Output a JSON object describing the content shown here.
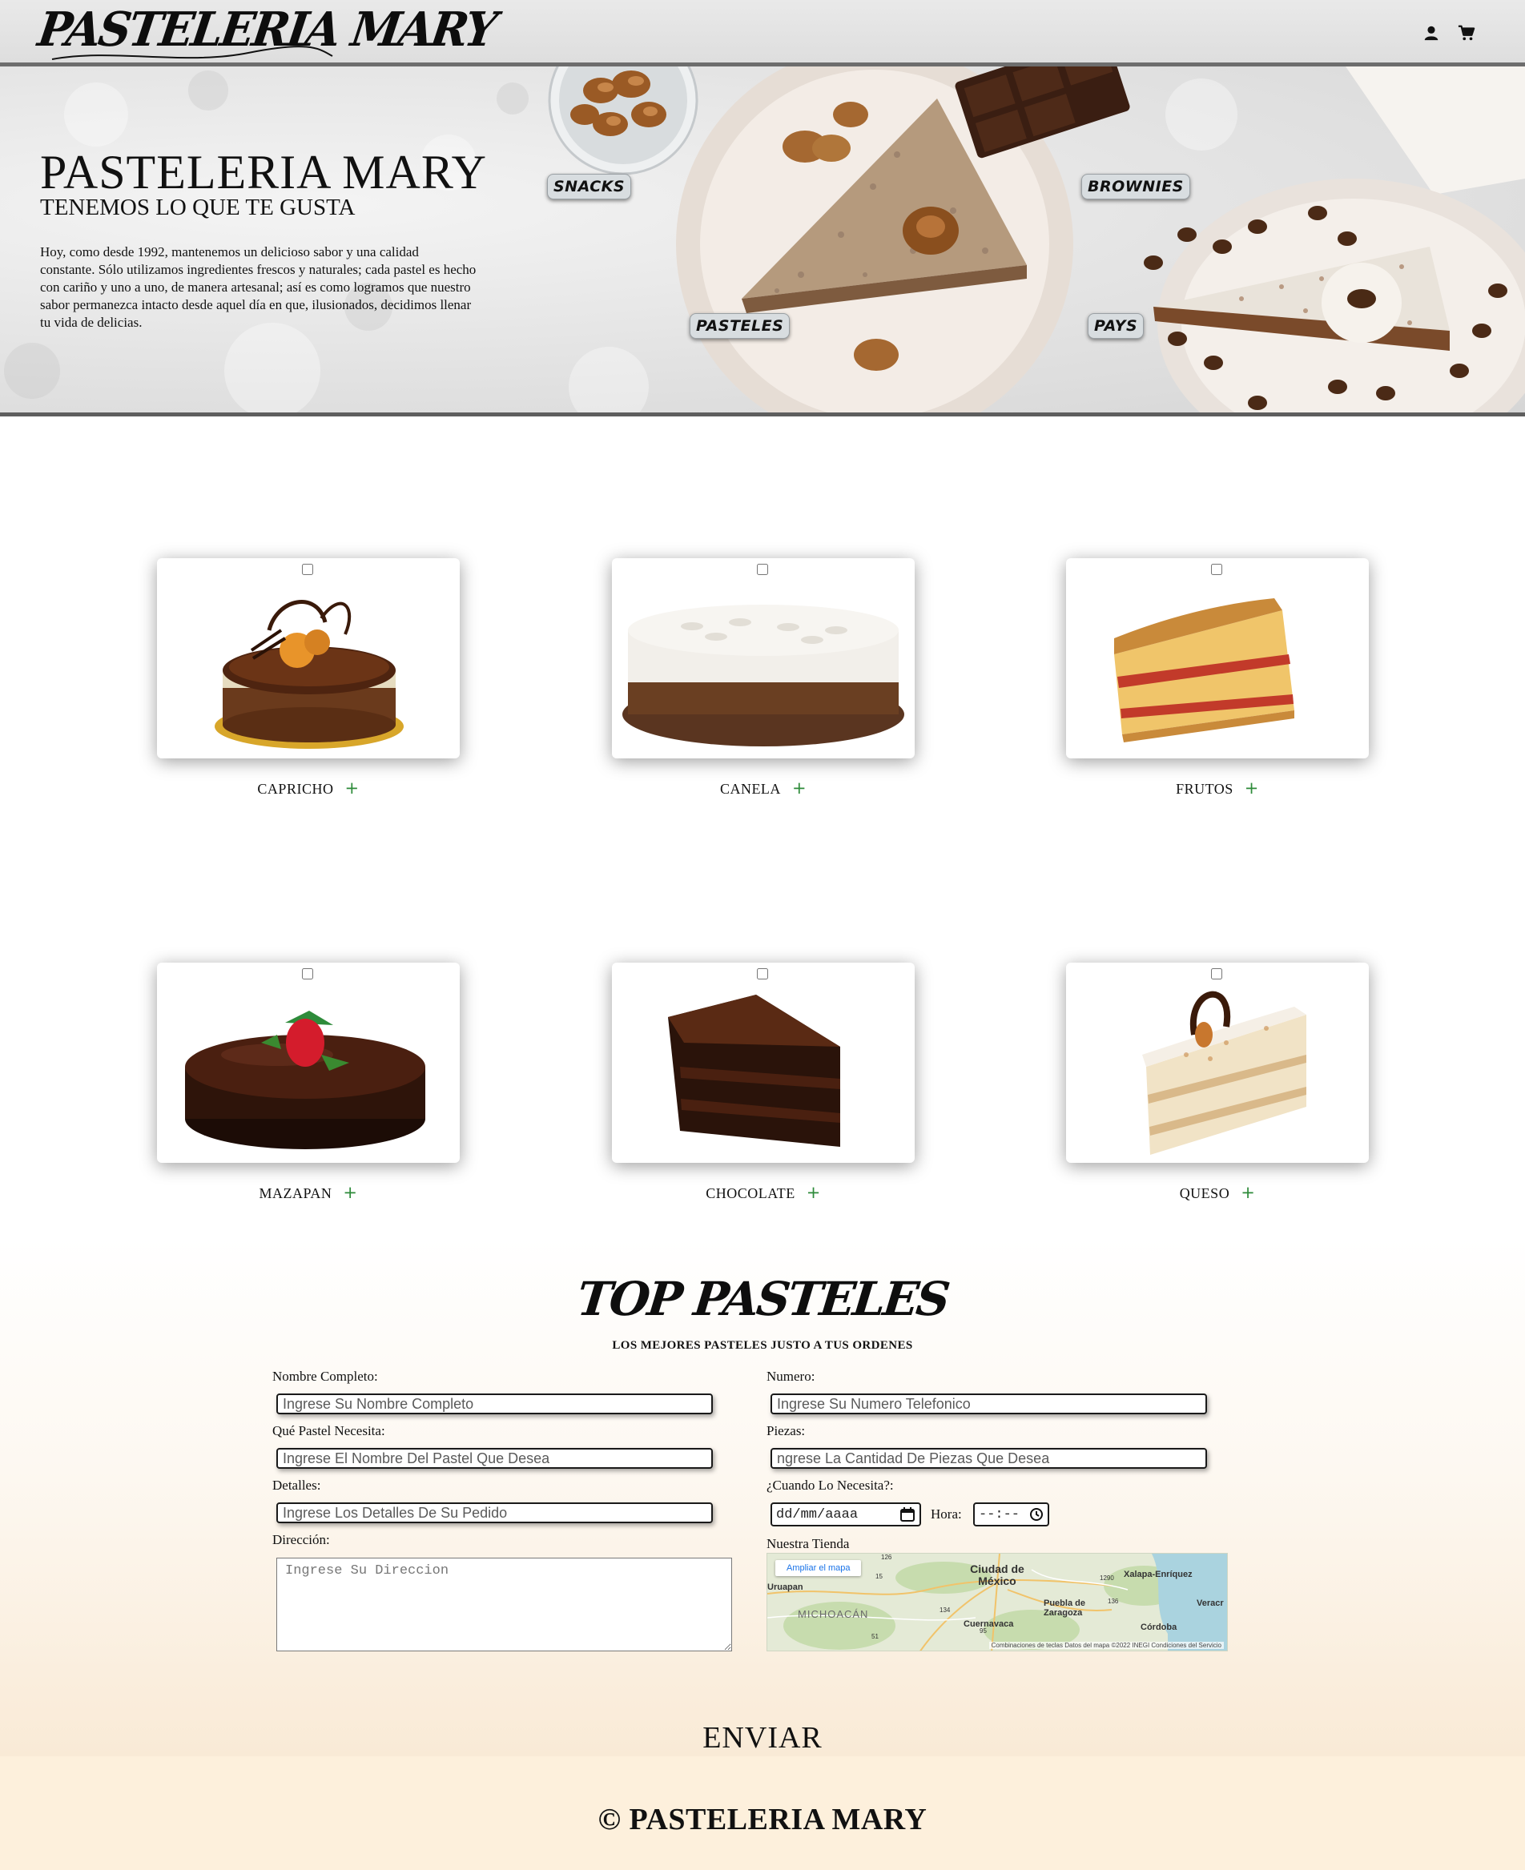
{
  "header": {
    "logo_text": "PASTELERIA MARY",
    "icons": [
      "user-icon",
      "cart-icon"
    ]
  },
  "hero": {
    "title": "PASTELERIA MARY",
    "subtitle": "TENEMOS LO QUE TE GUSTA",
    "description": "Hoy, como desde 1992, mantenemos un delicioso sabor y una calidad constante. Sólo utilizamos ingredientes frescos y naturales; cada pastel es hecho con cariño y uno a uno, de manera artesanal; así es como logramos que nuestro sabor permanezca intacto desde aquel día en que, ilusionados, decidimos llenar tu vida de delicias.",
    "tags": [
      "SNACKS",
      "BROWNIES",
      "PASTELES",
      "PAYS"
    ]
  },
  "products": [
    {
      "name": "CAPRICHO",
      "checked": false
    },
    {
      "name": "CANELA",
      "checked": false
    },
    {
      "name": "FRUTOS",
      "checked": false
    },
    {
      "name": "MAZAPAN",
      "checked": false
    },
    {
      "name": "CHOCOLATE",
      "checked": false
    },
    {
      "name": "QUESO",
      "checked": false
    }
  ],
  "plus_symbol": "+",
  "top_section": {
    "title": "TOP PASTELES",
    "subtitle": "LOS MEJORES PASTELES JUSTO A TUS ORDENES"
  },
  "form": {
    "name_label": "Nombre Completo:",
    "name_placeholder": "Ingrese Su Nombre Completo",
    "cake_label": "Qué Pastel Necesita:",
    "cake_placeholder": "Ingrese El Nombre Del Pastel Que Desea",
    "details_label": "Detalles:",
    "details_placeholder": "Ingrese Los Detalles De Su Pedido",
    "address_label": "Dirección:",
    "address_placeholder": "Ingrese Su Direccion",
    "phone_label": "Numero:",
    "phone_placeholder": "Ingrese Su Numero Telefonico",
    "pieces_label": "Piezas:",
    "pieces_placeholder": "ngrese La Cantidad De Piezas Que Desea",
    "when_label": "¿Cuando Lo Necesita?:",
    "date_value": "dd/mm/aaaa",
    "hour_label": "Hora:",
    "time_value": "--:--",
    "store_label": "Nuestra Tienda",
    "submit_label": "ENVIAR"
  },
  "map": {
    "enlarge_label": "Ampliar el mapa",
    "places": [
      "Ciudad de México",
      "Xalapa-Enríquez",
      "Uruapan",
      "MICHOACÁN",
      "Puebla de Zaragoza",
      "Cuernavaca",
      "Veracr",
      "Córdoba"
    ],
    "road_labels": [
      "126",
      "15",
      "1290",
      "136",
      "134",
      "95",
      "51"
    ],
    "attribution": "Combinaciones de teclas   Datos del mapa ©2022 INEGI   Condiciones del Servicio"
  },
  "footer": {
    "text": "© PASTELERIA MARY"
  }
}
